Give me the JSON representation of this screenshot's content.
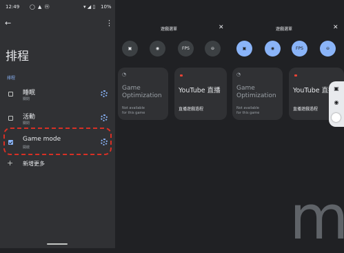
{
  "status_bar": {
    "time": "12:49",
    "icons": "◯ ▲ ⓜ",
    "right_icons": "▾ ◢ ▯",
    "battery": "10%"
  },
  "header": {
    "back_icon": "←",
    "menu_icon": "⋮"
  },
  "page": {
    "title": "排程",
    "section": "排程"
  },
  "rows": [
    {
      "title": "睡眠",
      "status": "關閉",
      "checked": false
    },
    {
      "title": "活動",
      "status": "關閉",
      "checked": false
    },
    {
      "title": "Game mode",
      "status": "開啟",
      "checked": true
    }
  ],
  "add_more": {
    "icon": "+",
    "label": "新增更多"
  },
  "dashboards": [
    {
      "title": "遊戲選單",
      "close": "✕",
      "buttons": [
        {
          "icon": "screenshot-icon",
          "glyph": "▣",
          "active": false
        },
        {
          "icon": "record-icon",
          "glyph": "◉",
          "active": false
        },
        {
          "icon": "fps-icon",
          "glyph": "FPS",
          "active": false
        },
        {
          "icon": "dnd-icon",
          "glyph": "⊖",
          "active": false
        }
      ],
      "card_opt": {
        "icon": "◔",
        "line1": "Game",
        "line2": "Optimization",
        "note1": "Not available",
        "note2": "for this game"
      },
      "card_yt": {
        "title": "YouTube 直播",
        "subtitle": "直播遊戲過程"
      }
    },
    {
      "title": "遊戲選單",
      "close": "✕",
      "buttons": [
        {
          "icon": "screenshot-icon",
          "glyph": "▣",
          "active": true
        },
        {
          "icon": "record-icon",
          "glyph": "◉",
          "active": true
        },
        {
          "icon": "fps-icon",
          "glyph": "FPS",
          "active": true
        },
        {
          "icon": "dnd-icon",
          "glyph": "⊖",
          "active": true
        }
      ],
      "card_opt": {
        "icon": "◔",
        "line1": "Game",
        "line2": "Optimization",
        "note1": "Not available",
        "note2": "for this game"
      },
      "card_yt": {
        "title": "YouTube 直播",
        "subtitle": "直播遊戲過程"
      }
    }
  ],
  "floating_tools": {
    "screenshot": "▣",
    "record": "◉"
  },
  "watermark": "m",
  "colors": {
    "accent": "#8ab4f8",
    "highlight": "#d93025",
    "panel": "#303134",
    "background": "#202124"
  }
}
